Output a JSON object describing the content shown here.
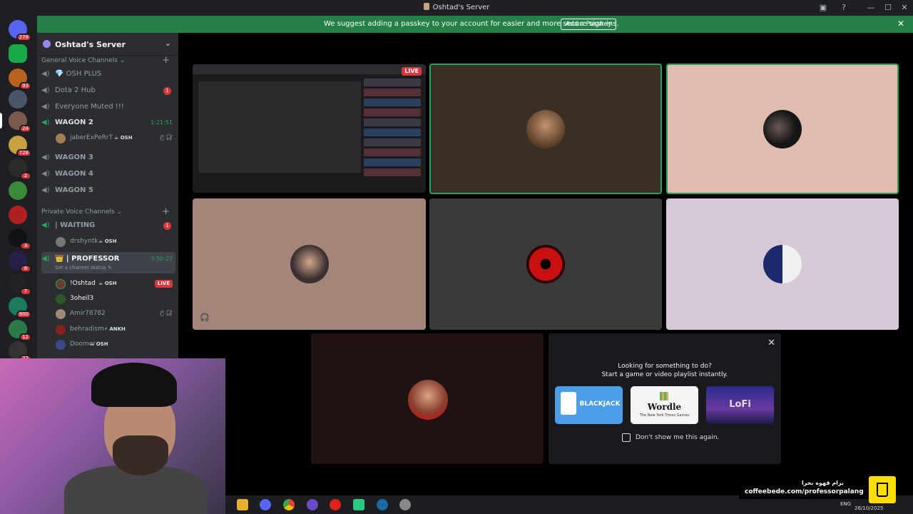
{
  "window": {
    "title": "Oshtad's Server",
    "controls": {
      "minimize": "—",
      "maximize": "☐",
      "close": "✕"
    }
  },
  "notice": {
    "message": "We suggest adding a passkey to your account for easier and more secure sign-ins.",
    "button": "Add a Passkey",
    "close": "✕"
  },
  "rail": {
    "badges": [
      "278",
      "93",
      "24",
      "728",
      "2",
      "3",
      "8",
      "7",
      "900",
      "12",
      "72"
    ]
  },
  "server": {
    "name": "Oshtad's Server",
    "chevron": "⌄"
  },
  "sidebar": {
    "category_general": "General Voice Channels ⌄",
    "category_private": "Private Voice Channels ⌄",
    "add": "+",
    "speaker_glyph": "◀)",
    "channels_general": [
      {
        "label": "💎 OSH PLUS"
      },
      {
        "label": "Dota 2 Hub",
        "count": "1"
      },
      {
        "label": "Everyone Muted !!!"
      },
      {
        "label": "WAGON 2",
        "timer": "1:21:51"
      },
      {
        "label": "WAGON 3"
      },
      {
        "label": "WAGON 4"
      },
      {
        "label": "WAGON 5"
      }
    ],
    "wagon2_user": {
      "name": "jaberExPeRrT",
      "tag": "☕ OSH"
    },
    "waiting": {
      "label": "| WAITING",
      "count": "1"
    },
    "waiting_user": {
      "name": "drshyntk",
      "tag": "☕ OSH"
    },
    "professor": {
      "label": "👑 | PROFESSOR",
      "timer": "3:50:27",
      "status": "Set a channel status ✎"
    },
    "professor_users": [
      {
        "name": "!Oshtad",
        "tag": "☕ OSH",
        "live": "LIVE"
      },
      {
        "name": "3oheil3"
      },
      {
        "name": "Amir78782"
      },
      {
        "name": "behradism",
        "tag": "⚡ ANKH"
      },
      {
        "name": "Doomer",
        "tag": "☕ OSH"
      }
    ],
    "mute_icons": "🎙̸ 🎧̸"
  },
  "stage": {
    "live_badge": "LIVE"
  },
  "activity": {
    "close": "✕",
    "line1": "Looking for something to do?",
    "line2": "Start a game or video playlist instantly.",
    "games": [
      "BLACKJACK",
      "Wordle",
      "LoFi"
    ],
    "wordle_sub": "The New York Times Games",
    "checkbox_label": "Don't show me this again."
  },
  "coffee": {
    "persian": "برام قهوه بخرا",
    "url": "coffeebede.com/professorpalang"
  },
  "taskbar": {
    "lang": "ENG",
    "date": "26/10/2025"
  },
  "colors": {
    "accent_green": "#23a55a",
    "notice_green": "#248046",
    "live_red": "#da373c",
    "sidebar_bg": "#2b2d31"
  }
}
